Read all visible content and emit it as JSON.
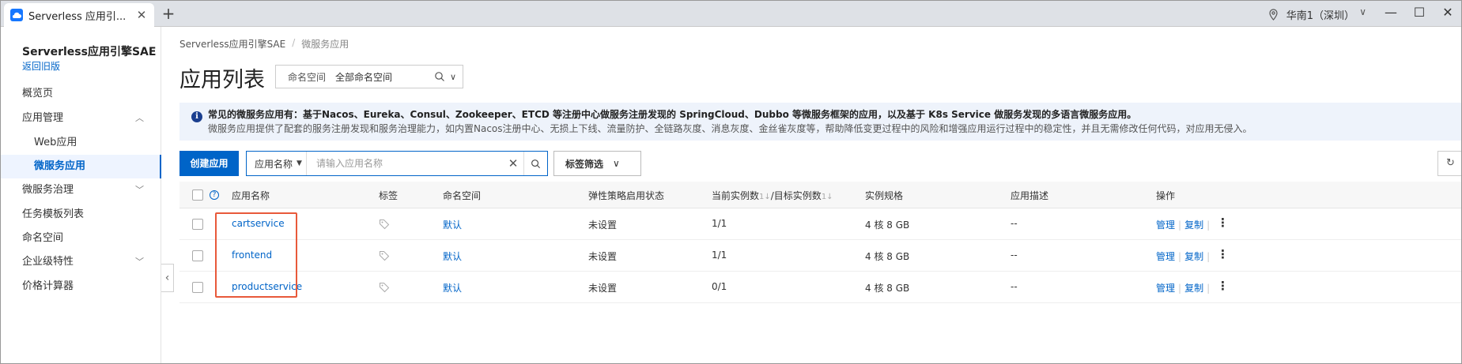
{
  "browser": {
    "tab_title": "Serverless 应用引...",
    "region": "华南1（深圳）"
  },
  "sidebar": {
    "brand": "Serverless应用引擎SAE",
    "back_link": "返回旧版",
    "items": [
      {
        "label": "概览页"
      },
      {
        "label": "应用管理"
      },
      {
        "label": "Web应用"
      },
      {
        "label": "微服务应用"
      },
      {
        "label": "微服务治理"
      },
      {
        "label": "任务模板列表"
      },
      {
        "label": "命名空间"
      },
      {
        "label": "企业级特性"
      },
      {
        "label": "价格计算器"
      }
    ]
  },
  "breadcrumb": {
    "root": "Serverless应用引擎SAE",
    "current": "微服务应用"
  },
  "page": {
    "title": "应用列表",
    "namespace_label": "命名空间",
    "namespace_value": "全部命名空间"
  },
  "notice": {
    "title": "常见的微服务应用有：基于Nacos、Eureka、Consul、Zookeeper、ETCD 等注册中心做服务注册发现的 SpringCloud、Dubbo 等微服务框架的应用，以及基于 K8s Service 做服务发现的多语言微服务应用。",
    "body": "微服务应用提供了配套的服务注册发现和服务治理能力，如内置Nacos注册中心、无损上下线、流量防护、全链路灰度、消息灰度、金丝雀灰度等，帮助降低变更过程中的风险和增强应用运行过程中的稳定性，并且无需修改任何代码，对应用无侵入。"
  },
  "toolbar": {
    "create_label": "创建应用",
    "search_field": "应用名称",
    "search_placeholder": "请输入应用名称",
    "tag_filter_label": "标签筛选"
  },
  "table": {
    "headers": {
      "name": "应用名称",
      "tags": "标签",
      "namespace": "命名空间",
      "policy": "弹性策略启用状态",
      "instances": "当前实例数",
      "instances_sep": "/目标实例数",
      "spec": "实例规格",
      "desc": "应用描述",
      "ops": "操作"
    },
    "rows": [
      {
        "name": "cartservice",
        "namespace": "默认",
        "policy": "未设置",
        "instances": "1/1",
        "spec": "4 核 8 GB",
        "desc": "--",
        "op_manage": "管理",
        "op_copy": "复制"
      },
      {
        "name": "frontend",
        "namespace": "默认",
        "policy": "未设置",
        "instances": "1/1",
        "spec": "4 核 8 GB",
        "desc": "--",
        "op_manage": "管理",
        "op_copy": "复制"
      },
      {
        "name": "productservice",
        "namespace": "默认",
        "policy": "未设置",
        "instances": "0/1",
        "spec": "4 核 8 GB",
        "desc": "--",
        "op_manage": "管理",
        "op_copy": "复制"
      }
    ]
  },
  "colors": {
    "accent": "#0064c8",
    "highlight": "#e8593a"
  }
}
